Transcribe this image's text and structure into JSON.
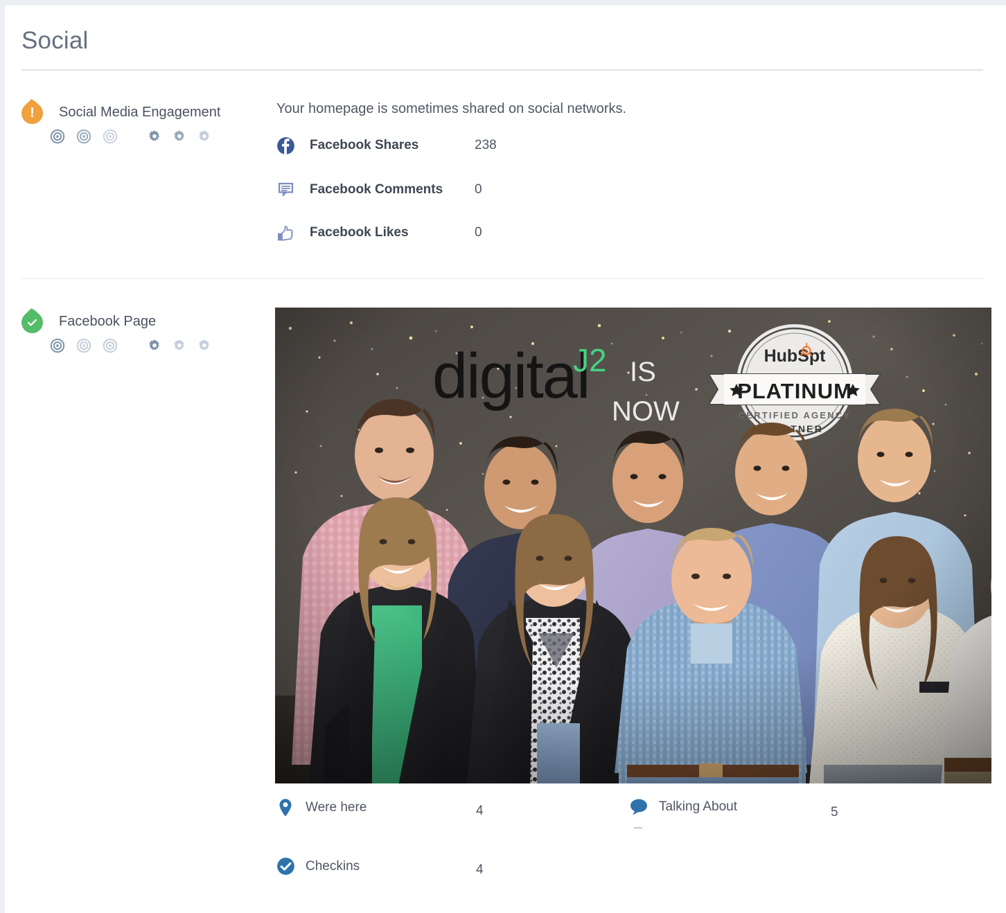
{
  "page": {
    "title": "Social"
  },
  "sections": [
    {
      "id": "social-media-engagement",
      "status": "warning",
      "status_icon": "exclamation-badge-icon",
      "label": "Social Media Engagement",
      "intro": "Your homepage is sometimes shared on social networks.",
      "targets": [
        {
          "name": "target-icon-1",
          "opacity": 1.0
        },
        {
          "name": "target-icon-2",
          "opacity": 0.78
        },
        {
          "name": "target-icon-3",
          "opacity": 0.42
        }
      ],
      "gears": [
        {
          "name": "gear-icon-1",
          "opacity": 1.0
        },
        {
          "name": "gear-icon-2",
          "opacity": 0.8
        },
        {
          "name": "gear-icon-3",
          "opacity": 0.45
        }
      ],
      "metrics": [
        {
          "icon": "facebook-f-icon",
          "label": "Facebook Shares",
          "value": "238"
        },
        {
          "icon": "facebook-comment-icon",
          "label": "Facebook Comments",
          "value": "0"
        },
        {
          "icon": "facebook-thumbs-up-icon",
          "label": "Facebook Likes",
          "value": "0"
        }
      ]
    },
    {
      "id": "facebook-page",
      "status": "ok",
      "status_icon": "check-badge-icon",
      "label": "Facebook Page",
      "targets": [
        {
          "name": "target-icon-1",
          "opacity": 1.0
        },
        {
          "name": "target-icon-2",
          "opacity": 0.45
        },
        {
          "name": "target-icon-3",
          "opacity": 0.45
        }
      ],
      "gears": [
        {
          "name": "gear-icon-1",
          "opacity": 1.0
        },
        {
          "name": "gear-icon-2",
          "opacity": 0.45
        },
        {
          "name": "gear-icon-3",
          "opacity": 0.45
        }
      ],
      "cover_photo": {
        "alt": "Team photo in front of dark confetti backdrop",
        "overlay_text": {
          "brand": "digital",
          "brand_suffix": "J2",
          "line1": "IS",
          "line2": "NOW"
        },
        "badge": {
          "brand": "HubSp",
          "brand_tail": "t",
          "tier": "PLATINUM",
          "line1": "CERTIFIED AGENCY",
          "line2": "PARTNER"
        }
      },
      "stats": [
        {
          "icon": "map-pin-icon",
          "label": "Were here",
          "value": "4"
        },
        {
          "icon": "speech-bubble-icon",
          "label": "Talking About",
          "value": "5"
        },
        {
          "icon": "check-circle-icon",
          "label": "Checkins",
          "value": "4"
        }
      ]
    }
  ],
  "colors": {
    "warning": "#f0a03c",
    "ok": "#55bc6a",
    "facebook_blue": "#3b5998",
    "stat_blue": "#2f72ab",
    "brand_green": "#4bd67d",
    "icon_steel": "#8095ab"
  }
}
